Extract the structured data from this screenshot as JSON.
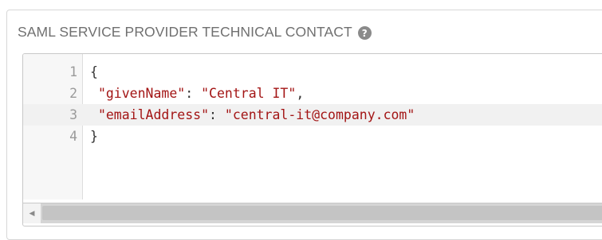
{
  "field": {
    "label": "SAML SERVICE PROVIDER TECHNICAL CONTACT",
    "help_icon": "question-circle-icon",
    "help_glyph": "?"
  },
  "editor": {
    "lines": [
      {
        "number": "1",
        "text": "{"
      },
      {
        "number": "2",
        "key": "\"givenName\"",
        "sep": ": ",
        "value": "\"Central IT\"",
        "end": ","
      },
      {
        "number": "3",
        "key": "\"emailAddress\"",
        "sep": ": ",
        "value": "\"central-it@company.com\"",
        "end": ""
      },
      {
        "number": "4",
        "text": "}"
      }
    ],
    "active_line": 3,
    "token_color": "#a31515"
  },
  "scrollbar": {
    "left_arrow": "◀",
    "left_arrow_icon": "caret-left-icon"
  }
}
